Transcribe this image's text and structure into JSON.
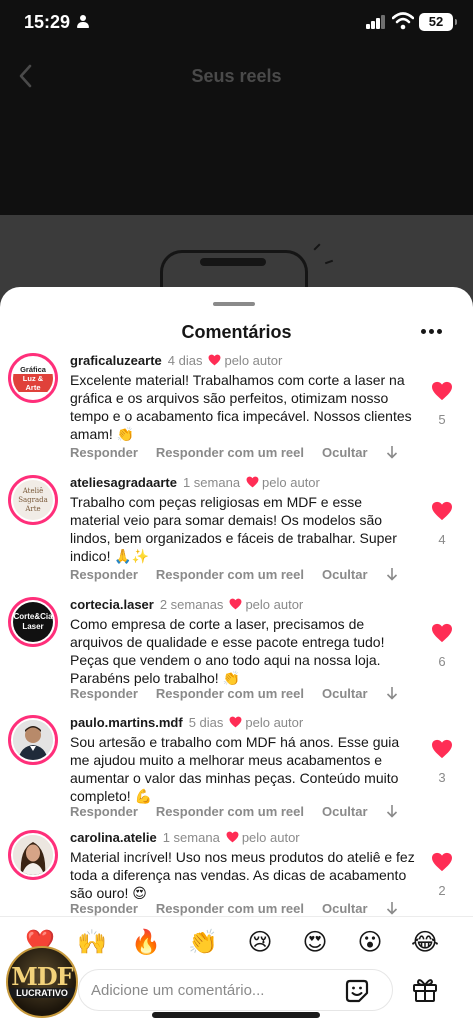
{
  "status_bar": {
    "time": "15:29",
    "battery": "52"
  },
  "header": {
    "title": "Seus reels"
  },
  "sheet": {
    "title": "Comentários"
  },
  "comments": [
    {
      "username": "graficaluzearte",
      "time": "4 dias",
      "by_author": "pelo autor",
      "text": "Excelente material! Trabalhamos com corte a laser na gráfica e os arquivos são perfeitos, otimizam nosso tempo e o acabamento fica impecável. Nossos clientes amam! 👏",
      "likes": "5",
      "avatar_text": [
        "Gráfica",
        "Luz & Arte"
      ]
    },
    {
      "username": "ateliesagradaarte",
      "time": "1 semana",
      "by_author": "pelo autor",
      "text": "Trabalho com peças religiosas em MDF e esse material veio para somar demais! Os modelos são lindos, bem organizados e fáceis de trabalhar. Super indico! 🙏✨",
      "likes": "4",
      "avatar_text": [
        "Ateliê",
        "Sagrada",
        "Arte"
      ]
    },
    {
      "username": "cortecia.laser",
      "time": "2 semanas",
      "by_author": "pelo autor",
      "text": "Como empresa de corte a laser, precisamos de arquivos de qualidade e esse pacote entrega tudo! Peças que vendem o ano todo aqui na nossa loja. Parabéns pelo trabalho! 👏",
      "likes": "6",
      "avatar_text": [
        "Corte&Cia",
        "Laser"
      ]
    },
    {
      "username": "paulo.martins.mdf",
      "time": "5 dias",
      "by_author": "pelo autor",
      "text": "Sou artesão e trabalho com MDF há anos. Esse guia me ajudou muito a melhorar meus acabamentos e aumentar o valor das minhas peças. Conteúdo muito completo! 💪",
      "likes": "3",
      "avatar_text": []
    },
    {
      "username": "carolina.atelie",
      "time": "1 semana",
      "by_author": "pelo autor",
      "text": "Material incrível! Uso nos meus produtos do ateliê e fez toda a diferença nas vendas. As dicas de acabamento são ouro! 😍",
      "likes": "2",
      "avatar_text": []
    }
  ],
  "actions": {
    "reply": "Responder",
    "reply_reel": "Responder com um reel",
    "hide": "Ocultar"
  },
  "emojis": [
    "❤️",
    "🙌",
    "🔥",
    "👏",
    "😢",
    "😍",
    "😮",
    "😂"
  ],
  "input": {
    "placeholder": "Adicione um comentário..."
  },
  "watermark": {
    "big": "MDF",
    "small": "LUCRATIVO"
  },
  "colors": {
    "heart": "#ff2d55",
    "avatar_ring": "#ff2f7a",
    "muted": "#8a8a8a"
  },
  "icons": [
    "person-icon",
    "signal-icon",
    "wifi-icon",
    "battery-icon",
    "back-icon",
    "more-icon",
    "heart-icon",
    "chevron-down-icon",
    "sticker-icon",
    "gift-icon"
  ]
}
